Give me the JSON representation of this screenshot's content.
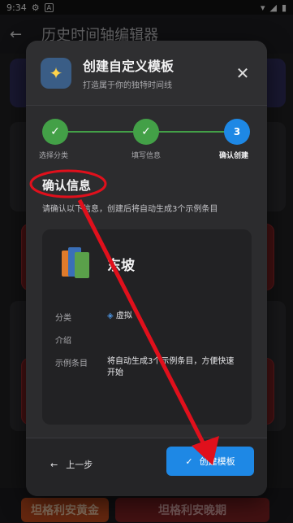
{
  "status": {
    "time": "9:34",
    "app_badge": "A"
  },
  "app": {
    "title": "历史时间轴编辑器"
  },
  "dialog": {
    "title": "创建自定义模板",
    "subtitle": "打造属于你的独特时间线",
    "steps": [
      "选择分类",
      "填写信息",
      "确认创建"
    ],
    "current_step_number": "3",
    "section_title": "确认信息",
    "section_desc": "请确认以下信息，创建后将自动生成3个示例条目",
    "template_name": "东坡",
    "fields": [
      {
        "label": "分类",
        "value": "虚拟"
      },
      {
        "label": "介绍",
        "value": ""
      },
      {
        "label": "示例条目",
        "value": "将自动生成3个示例条目，方便快速开始"
      }
    ],
    "back_label": "上一步",
    "create_label": "创建模板"
  },
  "background": {
    "tag_left": "坦格利安黄金",
    "tag_right": "坦格利安晚期"
  },
  "colors": {
    "accent": "#1e88e5",
    "success": "#43a047",
    "annotation": "#e0101c"
  }
}
